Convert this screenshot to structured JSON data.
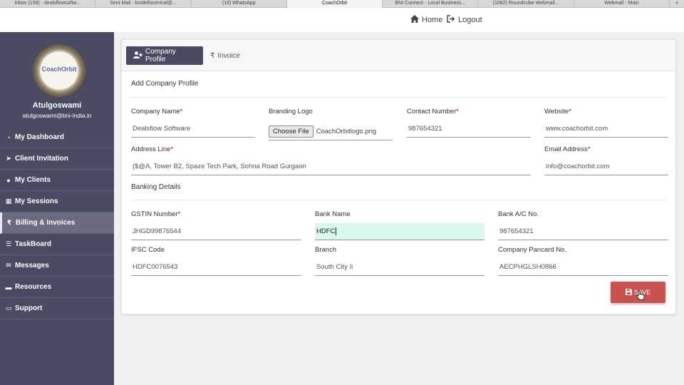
{
  "browser_tabs": [
    {
      "label": "Inbox (156) - dealsflowsoftw..."
    },
    {
      "label": "Sent Mail - bnidelhicentral@..."
    },
    {
      "label": "(16) WhatsApp"
    },
    {
      "label": "CoachOrbit"
    },
    {
      "label": "BNI Connect - Local Business..."
    },
    {
      "label": "(1082) Roundcube Webmail..."
    },
    {
      "label": "Webmail - Main"
    }
  ],
  "topnav": {
    "home_label": "Home",
    "logout_label": "Logout",
    "home_icon": "home-icon",
    "logout_icon": "logout-icon"
  },
  "sidebar": {
    "logo_text": "CoachOrbit",
    "user_name": "Atulgoswami",
    "user_email": "atulgoswami@bni-india.in",
    "items": [
      {
        "label": "My Dashboard",
        "icon": "dashboard-icon",
        "glyph": "◔"
      },
      {
        "label": "Client Invitation",
        "icon": "paper-plane-icon",
        "glyph": "➤"
      },
      {
        "label": "My Clients",
        "icon": "user-icon",
        "glyph": "●"
      },
      {
        "label": "My Sessions",
        "icon": "calendar-icon",
        "glyph": "▦"
      },
      {
        "label": "Billing & Invoices",
        "icon": "rupee-icon",
        "glyph": "₹"
      },
      {
        "label": "TaskBoard",
        "icon": "list-icon",
        "glyph": "☰"
      },
      {
        "label": "Messages",
        "icon": "envelope-icon",
        "glyph": "✉"
      },
      {
        "label": "Resources",
        "icon": "folder-icon",
        "glyph": "▬"
      },
      {
        "label": "Support",
        "icon": "support-icon",
        "glyph": "▭"
      }
    ]
  },
  "tabs": {
    "company_profile": "Company Profile",
    "invoice": "Invoice"
  },
  "form": {
    "section_title": "Add Company Profile",
    "company_name": {
      "label": "Company Name",
      "value": "Dealsflow Software"
    },
    "branding_logo": {
      "label": "Branding Logo",
      "button": "Choose File",
      "file": "CoachOrbitlogo.png"
    },
    "contact_number": {
      "label": "Contact Number",
      "value": "987654321"
    },
    "website": {
      "label": "Website",
      "value": "www.coachorbit.com"
    },
    "address_line": {
      "label": "Address Line",
      "value": "($@A, Tower B2, Spaze Tech Park, Sohna Road Gurgaon"
    },
    "email_address": {
      "label": "Email Address",
      "value": "info@coachorbit.com"
    },
    "banking_title": "Banking Details",
    "gstin": {
      "label": "GSTIN Number",
      "value": "JHGD99876544"
    },
    "bank_name": {
      "label": "Bank Name",
      "value": "HDFC"
    },
    "bank_ac": {
      "label": "Bank A/C No.",
      "value": "987654321"
    },
    "ifsc": {
      "label": "IFSC Code",
      "value": "HDFC0076543"
    },
    "branch": {
      "label": "Branch",
      "value": "South City Ii"
    },
    "pancard": {
      "label": "Company Pancard No.",
      "value": "AECPHGLSH0866"
    },
    "required_mark": "*"
  },
  "save_label": "SAVE",
  "colors": {
    "sidebar": "#4b4a63",
    "active_tab": "#4b4a63",
    "save_button": "#c9524f",
    "focus_field": "#d9f7ea",
    "required": "#d9534f"
  }
}
